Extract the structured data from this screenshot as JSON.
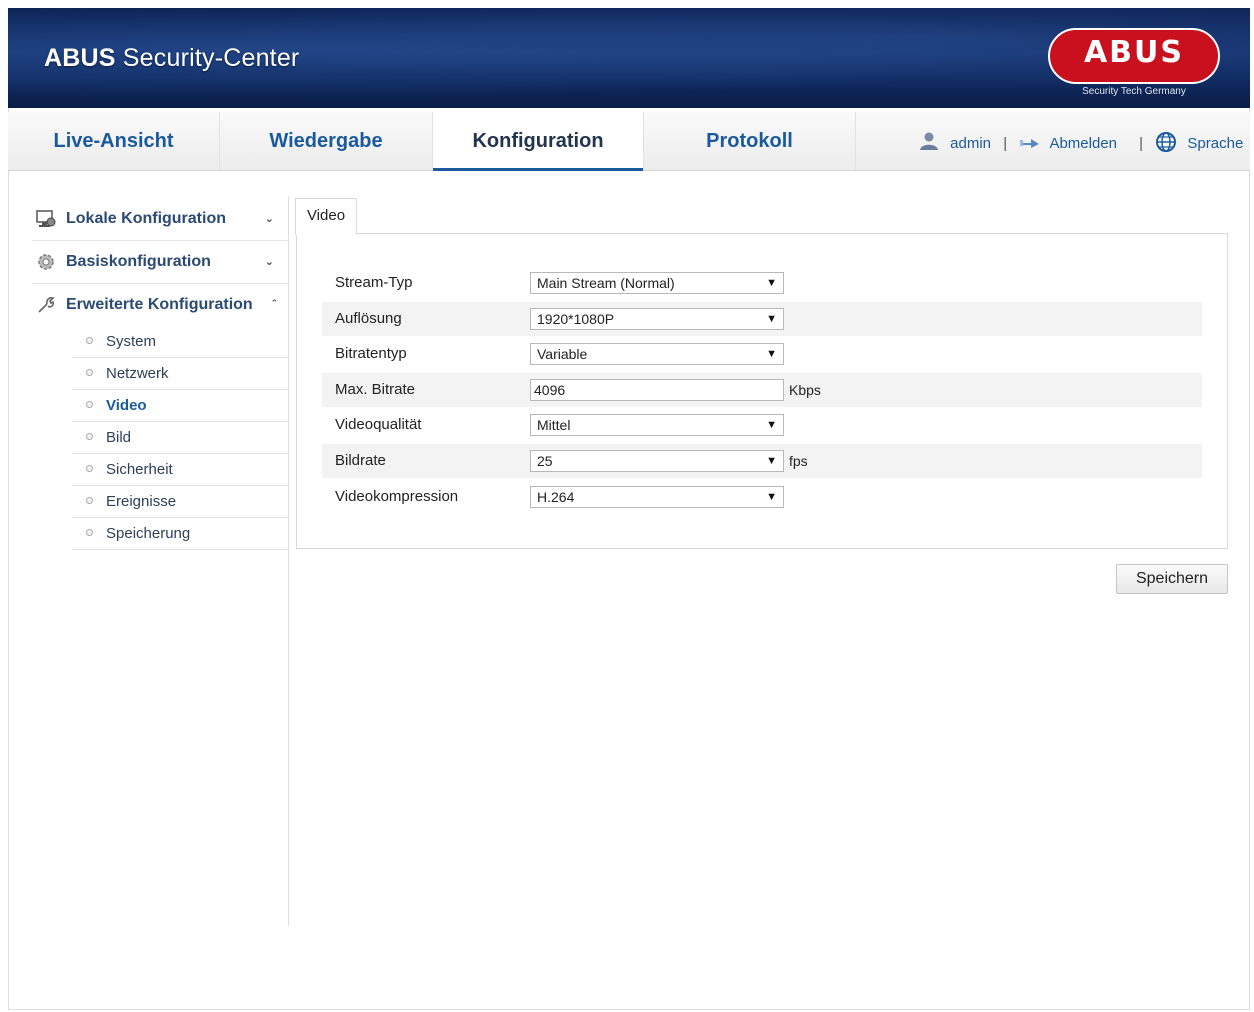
{
  "header": {
    "title_bold": "ABUS",
    "title_rest": " Security-Center",
    "logo_text": "ABUS",
    "logo_tagline": "Security Tech Germany",
    "brand_color": "#c8101e"
  },
  "nav": {
    "tabs": [
      {
        "label": "Live-Ansicht",
        "active": false
      },
      {
        "label": "Wiedergabe",
        "active": false
      },
      {
        "label": "Konfiguration",
        "active": true
      },
      {
        "label": "Protokoll",
        "active": false
      }
    ],
    "user": "admin",
    "logout": "Abmelden",
    "language": "Sprache",
    "separator": "|"
  },
  "sidebar": {
    "groups": [
      {
        "label": "Lokale Konfiguration",
        "icon": "local-config-icon",
        "expanded": false
      },
      {
        "label": "Basiskonfiguration",
        "icon": "gear-icon",
        "expanded": false
      },
      {
        "label": "Erweiterte Konfiguration",
        "icon": "wrench-icon",
        "expanded": true
      }
    ],
    "items": [
      {
        "label": "System"
      },
      {
        "label": "Netzwerk"
      },
      {
        "label": "Video",
        "active": true
      },
      {
        "label": "Bild"
      },
      {
        "label": "Sicherheit"
      },
      {
        "label": "Ereignisse"
      },
      {
        "label": "Speicherung"
      }
    ]
  },
  "content": {
    "tab": "Video",
    "rows": [
      {
        "label": "Stream-Typ",
        "value": "Main Stream (Normal)",
        "control": "select"
      },
      {
        "label": "Auflösung",
        "value": "1920*1080P",
        "control": "select"
      },
      {
        "label": "Bitratentyp",
        "value": "Variable",
        "control": "select"
      },
      {
        "label": "Max. Bitrate",
        "value": "4096",
        "control": "input",
        "unit": "Kbps"
      },
      {
        "label": "Videoqualität",
        "value": "Mittel",
        "control": "select"
      },
      {
        "label": "Bildrate",
        "value": "25",
        "control": "select",
        "unit": "fps"
      },
      {
        "label": "Videokompression",
        "value": "H.264",
        "control": "select"
      }
    ],
    "save_label": "Speichern"
  }
}
